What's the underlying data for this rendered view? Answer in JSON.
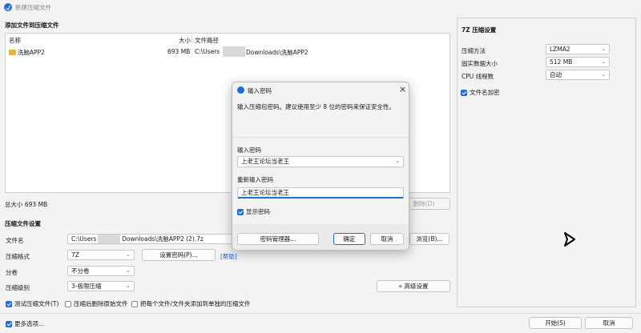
{
  "window": {
    "title": "新建压缩文件"
  },
  "files": {
    "section_title": "添加文件到压缩文件",
    "headers": {
      "name": "名称",
      "size": "大小",
      "path": "文件路径"
    },
    "rows": [
      {
        "name": "洗脑APP2",
        "size": "693 MB",
        "path_prefix": "C:\\Users",
        "path_suffix": "Downloads\\洗脑APP2"
      }
    ],
    "total": "总大小 693 MB",
    "delete_label": "删除(D)"
  },
  "settings7z": {
    "title": "7Z 压缩设置",
    "method_label": "压缩方法",
    "method_value": "LZMA2",
    "dict_label": "固实数据大小",
    "dict_value": "512 MB",
    "threads_label": "CPU 线程数",
    "threads_value": "自动",
    "encrypt_names_label": "文件名加密"
  },
  "archive": {
    "section_title": "压缩文件设置",
    "filename_label": "文件名",
    "filename_prefix": "C:\\Users",
    "filename_suffix": "Downloads\\洗脑APP2 (2).7z",
    "browse_label": "浏览(B)...",
    "format_label": "压缩格式",
    "format_value": "7Z",
    "set_password_label": "设置密码(P)...",
    "help_label": "[帮助]",
    "split_label": "分卷",
    "split_value": "不分卷",
    "level_label": "压缩级别",
    "level_value": "3-极限压缩",
    "advanced_label": "« 高级设置",
    "test_label": "测试压缩文件(T)",
    "delete_src_label": "压缩后删除原始文件",
    "separate_label": "把每个文件/文件夹添加到单独的压缩文件"
  },
  "footer": {
    "more_label": "更多选项...",
    "start_label": "开始(S)",
    "cancel_label": "取消"
  },
  "dialog": {
    "title": "输入密码",
    "desc": "输入压缩包密码。建议使用至少 8 位的密码来保证安全性。",
    "pw_label": "输入密码",
    "pw_value": "上老王论坛当老王",
    "confirm_label": "重新输入密码",
    "confirm_value": "上老王论坛当老王",
    "show_label": "显示密码",
    "manager_label": "密码管理器...",
    "ok_label": "确定",
    "cancel_label": "取消"
  }
}
